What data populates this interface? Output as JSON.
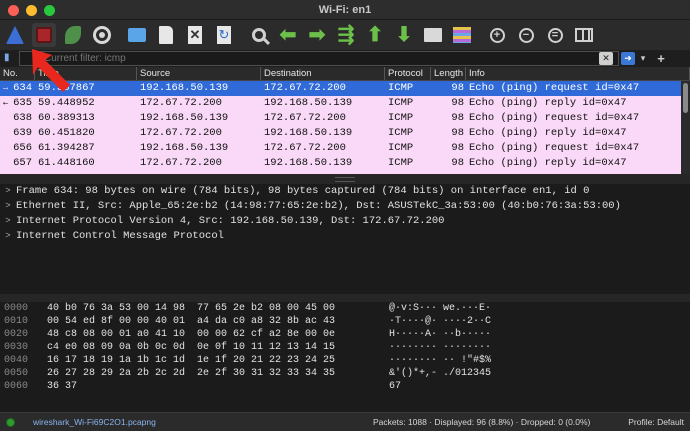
{
  "window": {
    "title": "Wi-Fi: en1"
  },
  "toolbar": {
    "buttons": [
      {
        "name": "start-capture",
        "icon": "shark-fin-icon"
      },
      {
        "name": "stop-capture",
        "icon": "stop-icon"
      },
      {
        "name": "restart-capture",
        "icon": "restart-icon"
      },
      {
        "name": "capture-options",
        "icon": "gear-icon"
      },
      {
        "name": "open-file",
        "icon": "folder-icon"
      },
      {
        "name": "save-file",
        "icon": "file-icon"
      },
      {
        "name": "close-file",
        "icon": "close-file-icon"
      },
      {
        "name": "reload-file",
        "icon": "reload-icon"
      },
      {
        "name": "find-packet",
        "icon": "search-icon"
      },
      {
        "name": "go-back",
        "icon": "arrow-left-icon"
      },
      {
        "name": "go-forward",
        "icon": "arrow-right-icon"
      },
      {
        "name": "go-to-packet",
        "icon": "goto-icon"
      },
      {
        "name": "go-first",
        "icon": "arrow-up-icon"
      },
      {
        "name": "go-last",
        "icon": "arrow-down-icon"
      },
      {
        "name": "auto-scroll",
        "icon": "autoscroll-icon"
      },
      {
        "name": "colorize",
        "icon": "colorize-icon"
      },
      {
        "name": "zoom-in",
        "icon": "zoom-in-icon"
      },
      {
        "name": "zoom-out",
        "icon": "zoom-out-icon"
      },
      {
        "name": "zoom-normal",
        "icon": "zoom-reset-icon"
      },
      {
        "name": "resize-columns",
        "icon": "resize-columns-icon"
      }
    ]
  },
  "filter": {
    "placeholder": "Current filter: icmp"
  },
  "packet_list": {
    "headers": [
      "No.",
      "Time",
      "Source",
      "Destination",
      "Protocol",
      "Length",
      "Info"
    ],
    "rows": [
      {
        "no": "634",
        "time": "59.387867",
        "src": "192.168.50.139",
        "dst": "172.67.72.200",
        "proto": "ICMP",
        "len": "98",
        "info": "Echo (ping) request  id=0x47"
      },
      {
        "no": "635",
        "time": "59.448952",
        "src": "172.67.72.200",
        "dst": "192.168.50.139",
        "proto": "ICMP",
        "len": "98",
        "info": "Echo (ping) reply    id=0x47"
      },
      {
        "no": "638",
        "time": "60.389313",
        "src": "192.168.50.139",
        "dst": "172.67.72.200",
        "proto": "ICMP",
        "len": "98",
        "info": "Echo (ping) request  id=0x47"
      },
      {
        "no": "639",
        "time": "60.451820",
        "src": "172.67.72.200",
        "dst": "192.168.50.139",
        "proto": "ICMP",
        "len": "98",
        "info": "Echo (ping) reply    id=0x47"
      },
      {
        "no": "656",
        "time": "61.394287",
        "src": "192.168.50.139",
        "dst": "172.67.72.200",
        "proto": "ICMP",
        "len": "98",
        "info": "Echo (ping) request  id=0x47"
      },
      {
        "no": "657",
        "time": "61.448160",
        "src": "172.67.72.200",
        "dst": "192.168.50.139",
        "proto": "ICMP",
        "len": "98",
        "info": "Echo (ping) reply    id=0x47"
      }
    ]
  },
  "details": [
    "Frame 634: 98 bytes on wire (784 bits), 98 bytes captured (784 bits) on interface en1, id 0",
    "Ethernet II, Src: Apple_65:2e:b2 (14:98:77:65:2e:b2), Dst: ASUSTekC_3a:53:00 (40:b0:76:3a:53:00)",
    "Internet Protocol Version 4, Src: 192.168.50.139, Dst: 172.67.72.200",
    "Internet Control Message Protocol"
  ],
  "hex": [
    {
      "off": "0000",
      "bytes": "40 b0 76 3a 53 00 14 98  77 65 2e b2 08 00 45 00",
      "ascii": "@·v:S··· we.···E·"
    },
    {
      "off": "0010",
      "bytes": "00 54 ed 8f 00 00 40 01  a4 da c0 a8 32 8b ac 43",
      "ascii": "·T····@· ····2··C"
    },
    {
      "off": "0020",
      "bytes": "48 c8 08 00 01 a0 41 10  00 00 62 cf a2 8e 00 0e",
      "ascii": "H·····A· ··b·····"
    },
    {
      "off": "0030",
      "bytes": "c4 e0 08 09 0a 0b 0c 0d  0e 0f 10 11 12 13 14 15",
      "ascii": "········ ········"
    },
    {
      "off": "0040",
      "bytes": "16 17 18 19 1a 1b 1c 1d  1e 1f 20 21 22 23 24 25",
      "ascii": "········ ·· !\"#$%"
    },
    {
      "off": "0050",
      "bytes": "26 27 28 29 2a 2b 2c 2d  2e 2f 30 31 32 33 34 35",
      "ascii": "&'()*+,- ./012345"
    },
    {
      "off": "0060",
      "bytes": "36 37",
      "ascii": "67"
    }
  ],
  "status": {
    "file": "wireshark_Wi-Fi69C2O1.pcapng",
    "packets": "Packets: 1088 · Displayed: 96 (8.8%) · Dropped: 0 (0.0%)",
    "profile": "Profile: Default"
  },
  "colors": {
    "selected_row": "#2f6ad8",
    "icmp_row": "#f9d9f7",
    "annotation": "#e8281e"
  }
}
